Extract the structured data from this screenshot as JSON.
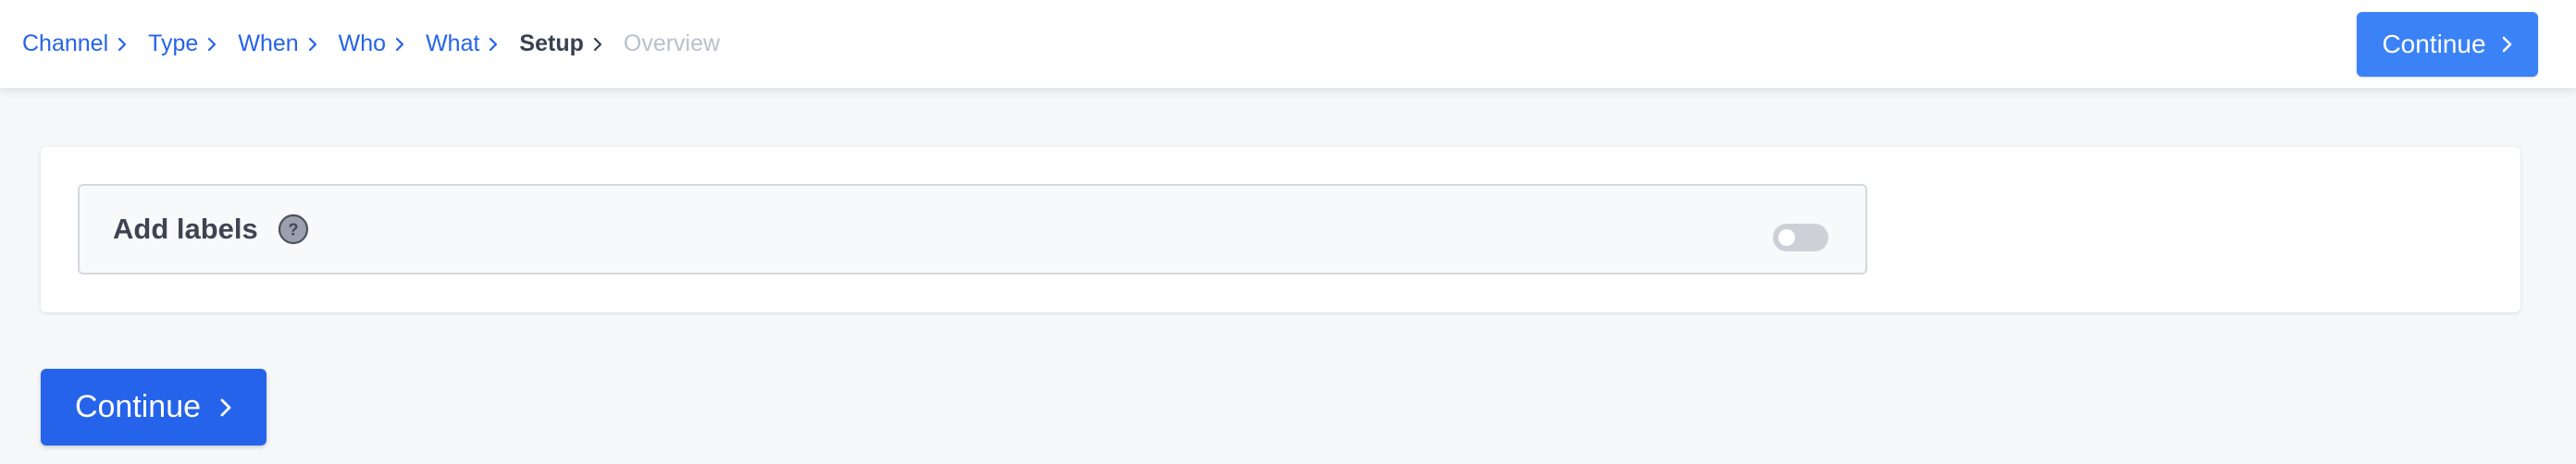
{
  "breadcrumb": [
    {
      "label": "Channel",
      "state": "link"
    },
    {
      "label": "Type",
      "state": "link"
    },
    {
      "label": "When",
      "state": "link"
    },
    {
      "label": "Who",
      "state": "link"
    },
    {
      "label": "What",
      "state": "link"
    },
    {
      "label": "Setup",
      "state": "current"
    },
    {
      "label": "Overview",
      "state": "disabled"
    }
  ],
  "header": {
    "continue_label": "Continue"
  },
  "setting": {
    "label": "Add labels",
    "help_icon": "question-circle-icon",
    "toggle_on": false
  },
  "footer": {
    "continue_label": "Continue"
  },
  "colors": {
    "link": "#2563eb",
    "primary_button": "#2563eb",
    "header_button": "#3b82f6",
    "disabled": "#b9c0cb"
  }
}
